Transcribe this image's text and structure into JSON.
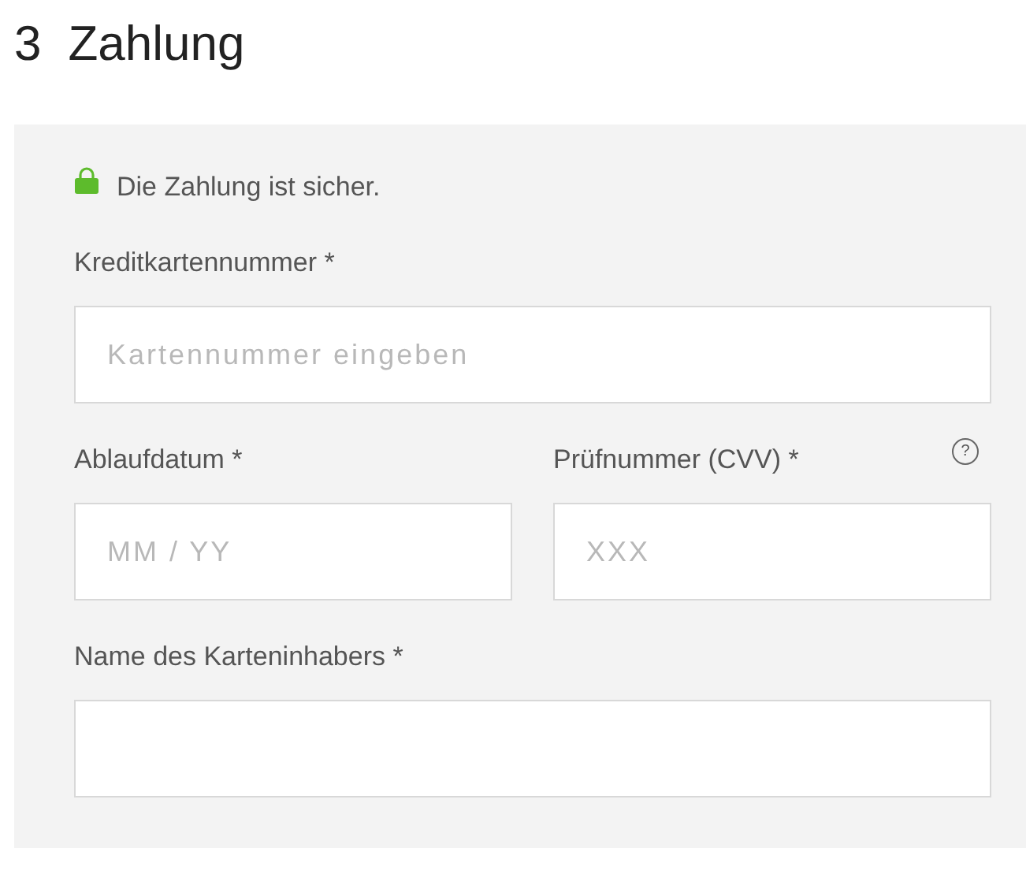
{
  "heading": {
    "number": "3",
    "title": "Zahlung"
  },
  "secure_note": "Die Zahlung ist sicher.",
  "card_number": {
    "label": "Kreditkartennummer *",
    "placeholder": "Kartennummer eingeben"
  },
  "expiry": {
    "label": "Ablaufdatum *",
    "placeholder": "MM / YY"
  },
  "cvv": {
    "label": "Prüfnummer (CVV) *",
    "placeholder": "XXX",
    "help": "?"
  },
  "holder": {
    "label": "Name des Karteninhabers *"
  }
}
